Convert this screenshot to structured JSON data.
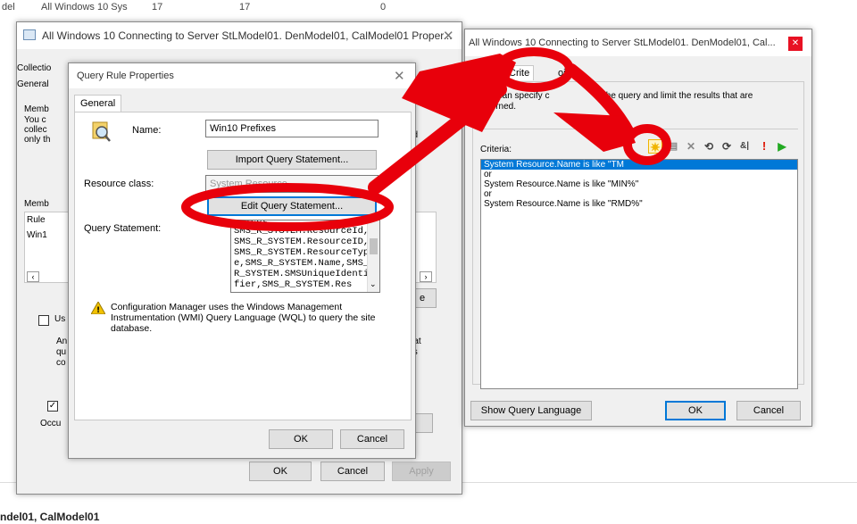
{
  "background": {
    "top_row": {
      "col1": "del",
      "col2": "All Windows 10 Sys",
      "col3": "17",
      "col4": "17",
      "col5": "0"
    },
    "bottom_text": "ndel01, CalModel01"
  },
  "collection_props": {
    "title": "All Windows 10 Connecting to Server StLModel01. DenModel01, CalModel01 Proper...",
    "tabs": [
      "Collectio",
      "General"
    ],
    "partial_labels": [
      "Memb",
      "You c",
      "collec",
      "only th",
      "Memb",
      "Rule",
      "Win1",
      "Us",
      "An",
      "qu",
      "co",
      "Occu"
    ],
    "right_partials": [
      "dd",
      "that",
      "his",
      "e"
    ],
    "buttons": {
      "ok": "OK",
      "cancel": "Cancel",
      "apply": "Apply"
    }
  },
  "query_rule": {
    "title": "Query Rule Properties",
    "tab": "General",
    "name_label": "Name:",
    "name_value": "Win10 Prefixes",
    "import_button": "Import Query Statement...",
    "resource_class_label": "Resource class:",
    "resource_class_value": "System Resource",
    "edit_button": "Edit Query Statement...",
    "query_statement_label": "Query Statement:",
    "query_lines": [
      "select SMS_R_SYSTEM.ResourceId,",
      "SMS_R_SYSTEM.ResourceID,",
      "SMS_R_SYSTEM.ResourceTyp",
      "e,SMS_R_SYSTEM.Name,SMS_",
      "R_SYSTEM.SMSUniqueIdenti",
      "fier,SMS_R_SYSTEM.Res"
    ],
    "warning_text": "Configuration Manager uses the Windows Management Instrumentation (WMI) Query Language (WQL) to query the site database.",
    "ok": "OK",
    "cancel": "Cancel"
  },
  "query_window": {
    "title": "All Windows 10 Connecting to Server StLModel01. DenModel01, Cal...",
    "tabs": [
      "Criteria",
      "Joins"
    ],
    "tab_visible": [
      "Crite",
      "oins"
    ],
    "description": "You can specify criteria to narrow the query and limit the results that are returned.",
    "description_visible": [
      "You can specify c",
      "w the query and limit the results that are",
      "returned."
    ],
    "criteria_label": "Criteria:",
    "criteria": [
      "System Resource.Name is like \"TM",
      "or",
      "System Resource.Name is like \"MIN%\"",
      "or",
      "System Resource.Name is like \"RMD%\""
    ],
    "show_query_language": "Show Query Language",
    "ok": "OK",
    "cancel": "Cancel"
  },
  "colors": {
    "annotation_red": "#e8000b",
    "selection_blue": "#0078d7",
    "close_red": "#e81123"
  }
}
